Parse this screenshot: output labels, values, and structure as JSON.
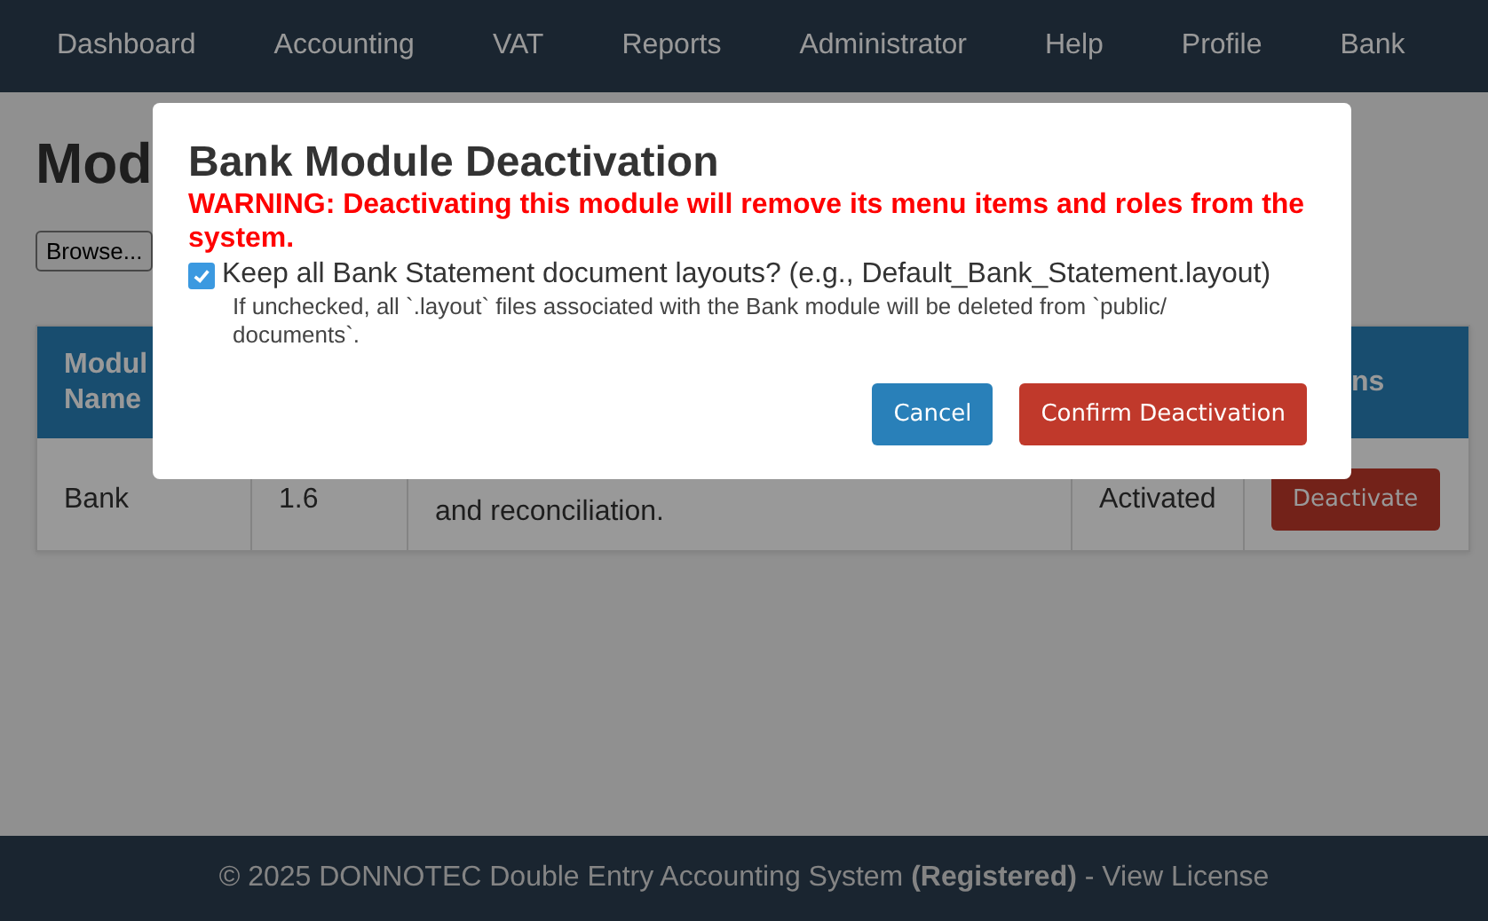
{
  "nav": {
    "items": [
      "Dashboard",
      "Accounting",
      "VAT",
      "Reports",
      "Administrator",
      "Help",
      "Profile",
      "Bank"
    ]
  },
  "page": {
    "title": "Mod",
    "browse_button": "Browse..."
  },
  "table": {
    "column_1": "Modul Name",
    "column_5": "ns",
    "rows": [
      {
        "name": "Bank",
        "version": "1.6",
        "description": "and reconciliation.",
        "status": "Activated",
        "action": "Deactivate"
      }
    ]
  },
  "modal": {
    "title": "Bank Module Deactivation",
    "warning": "WARNING: Deactivating this module will remove its menu items and roles from the system.",
    "checkbox": {
      "label": "Keep all Bank Statement document layouts? (e.g., Default_Bank_Statement.layout)",
      "checked": true
    },
    "hint": "If unchecked, all `.layout` files associated with the Bank module will be deleted from `public/ documents`.",
    "buttons": [
      {
        "label": "Cancel",
        "kind": "secondary"
      },
      {
        "label": "Confirm Deactivation",
        "kind": "danger"
      }
    ]
  },
  "footer": {
    "text": "© 2025 DONNOTEC Double Entry Accounting System **(Registered)** - View License"
  }
}
